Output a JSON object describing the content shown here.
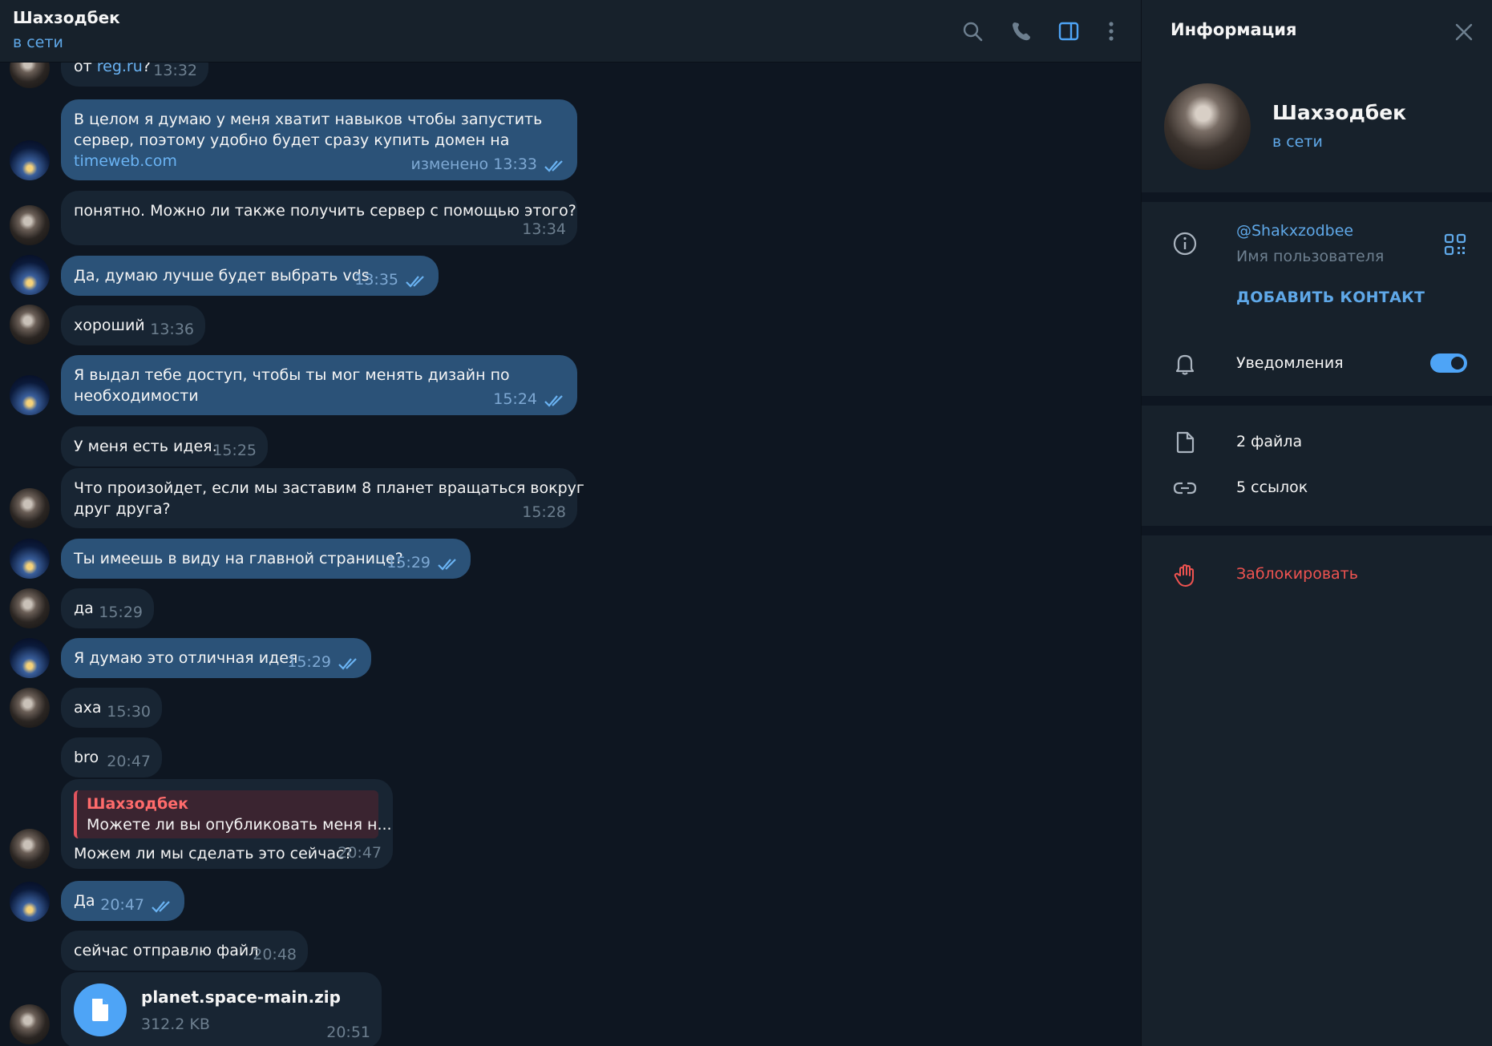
{
  "chat": {
    "contact_name": "Шахзодбек",
    "contact_status": "в сети"
  },
  "messages": [
    {
      "dir": "in",
      "text_prefix": "от ",
      "link": "reg.ru",
      "text_suffix": "?",
      "time": "13:32"
    },
    {
      "dir": "out",
      "lines": [
        "В целом я думаю у меня хватит навыков чтобы запустить",
        "сервер, поэтому удобно будет сразу купить домен на"
      ],
      "link": "timeweb.com",
      "edited": "изменено",
      "time": "13:33"
    },
    {
      "dir": "in",
      "text": "понятно. Можно ли также получить сервер с помощью этого?",
      "time": "13:34"
    },
    {
      "dir": "out",
      "text": "Да, думаю лучше будет выбрать vds",
      "time": "13:35"
    },
    {
      "dir": "in",
      "text": "хороший",
      "time": "13:36"
    },
    {
      "dir": "out",
      "lines": [
        "Я выдал тебе доступ, чтобы ты мог менять дизайн по",
        "необходимости"
      ],
      "time": "15:24"
    },
    {
      "dir": "in",
      "text": "У меня есть идея.",
      "time": "15:25"
    },
    {
      "dir": "in",
      "lines": [
        "Что произойдет, если мы заставим 8 планет вращаться вокруг",
        "друг друга?"
      ],
      "time": "15:28"
    },
    {
      "dir": "out",
      "text": "Ты имеешь в виду на главной странице?",
      "time": "15:29"
    },
    {
      "dir": "in",
      "text": "да",
      "time": "15:29"
    },
    {
      "dir": "out",
      "text": "Я думаю это отличная идея",
      "time": "15:29"
    },
    {
      "dir": "in",
      "text": "аха",
      "time": "15:30"
    },
    {
      "dir": "in",
      "text": "bro",
      "time": "20:47"
    },
    {
      "dir": "in",
      "reply_name": "Шахзодбек",
      "reply_text": "Можете ли вы опубликовать меня н...",
      "text": "Можем ли мы сделать это сейчас?",
      "time": "20:47"
    },
    {
      "dir": "out",
      "text": "Да",
      "time": "20:47"
    },
    {
      "dir": "in",
      "text": "сейчас отправлю файл",
      "time": "20:48"
    },
    {
      "dir": "in",
      "file_name": "planet.space-main.zip",
      "file_size": "312.2 KB",
      "time": "20:51"
    }
  ],
  "info_panel": {
    "title": "Информация",
    "profile_name": "Шахзодбек",
    "profile_status": "в сети",
    "username": "@Shakxzodbee",
    "username_label": "Имя пользователя",
    "add_contact": "ДОБАВИТЬ КОНТАКТ",
    "notifications_label": "Уведомления",
    "notifications_on": true,
    "files": "2 файла",
    "links": "5 ссылок",
    "block": "Заблокировать"
  },
  "icons": [
    "search-icon",
    "phone-icon",
    "sidebar-toggle-icon",
    "more-icon",
    "close-icon",
    "info-icon",
    "qr-code-icon",
    "bell-icon",
    "file-icon",
    "link-icon",
    "block-hand-icon",
    "double-check-icon"
  ],
  "colors": {
    "accent": "#5fa8e8",
    "outgoing_bubble": "#2b5278",
    "incoming_bubble": "#182533",
    "danger": "#ef5350"
  }
}
